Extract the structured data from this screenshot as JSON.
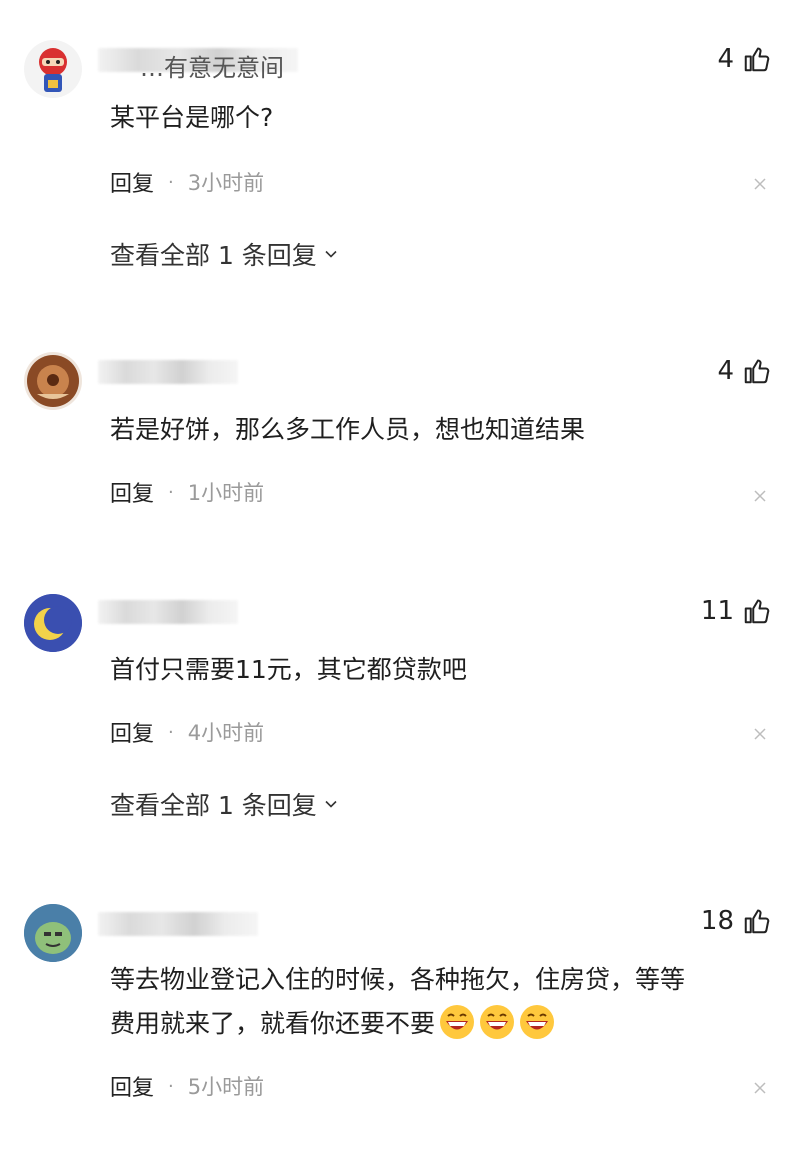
{
  "comments": [
    {
      "name_fragment": "…有意无意间",
      "likes": "4",
      "text": "某平台是哪个?",
      "reply_label": "回复",
      "time": "3小时前",
      "view_replies": "查看全部 1 条回复"
    },
    {
      "likes": "4",
      "text": "若是好饼，那么多工作人员，想也知道结果",
      "reply_label": "回复",
      "time": "1小时前"
    },
    {
      "likes": "11",
      "text": "首付只需要11元，其它都贷款吧",
      "reply_label": "回复",
      "time": "4小时前",
      "view_replies": "查看全部 1 条回复"
    },
    {
      "likes": "18",
      "text_line1": "等去物业登记入住的时候，各种拖欠，住房贷，等等",
      "text_line2": "费用就来了，就看你还要不要",
      "emoji_count": "3",
      "reply_label": "回复",
      "time": "5小时前"
    }
  ],
  "colors": {
    "meta": "#9a9a9a",
    "text": "#1f1f1f",
    "emoji": "#ffc83d"
  },
  "icons": [
    "thumbs-up-icon",
    "close-icon",
    "chevron-down-icon",
    "grinning-face-icon"
  ]
}
